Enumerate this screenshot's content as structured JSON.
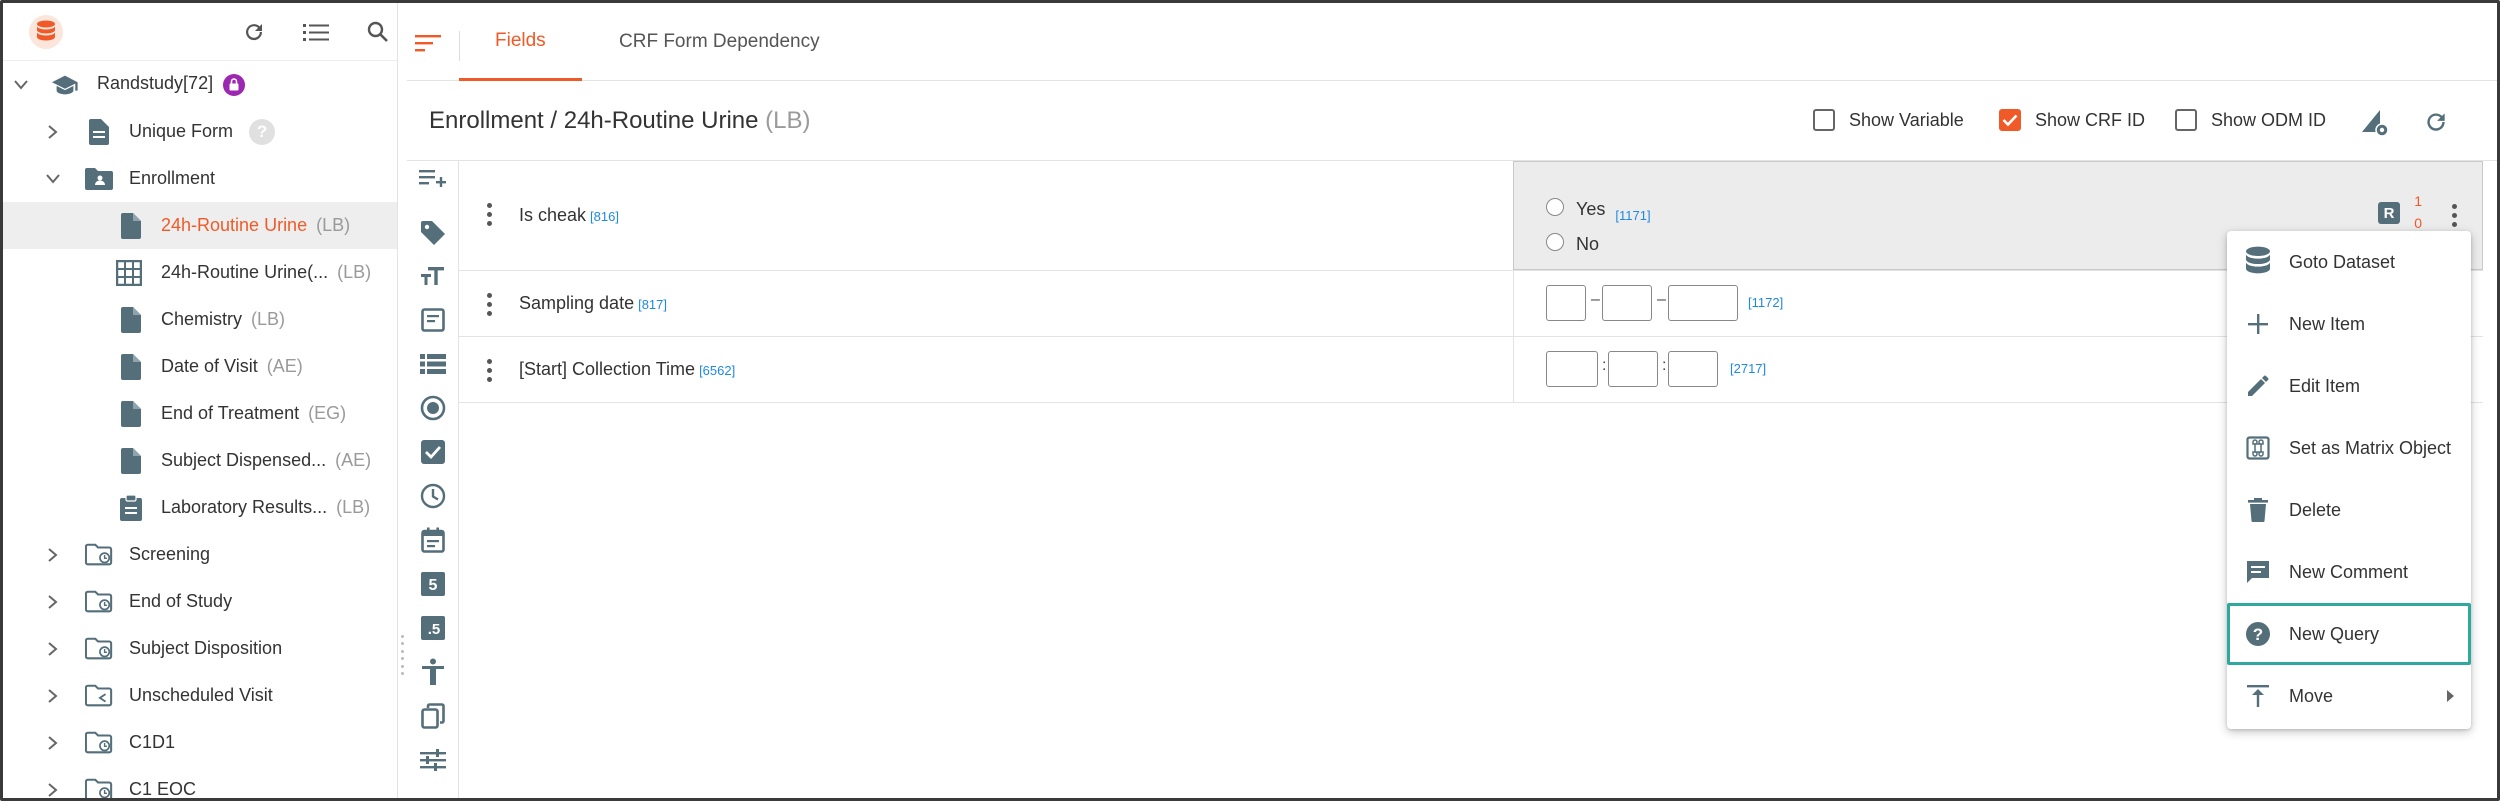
{
  "sidebar": {
    "study": {
      "label": "Randstudy[72]"
    },
    "items": [
      {
        "label": "Unique Form",
        "code": ""
      },
      {
        "label": "Enrollment",
        "code": ""
      },
      {
        "label": "24h-Routine Urine",
        "code": "(LB)"
      },
      {
        "label": "24h-Routine Urine(...",
        "code": "(LB)"
      },
      {
        "label": "Chemistry",
        "code": "(LB)"
      },
      {
        "label": "Date of Visit",
        "code": "(AE)"
      },
      {
        "label": "End of Treatment",
        "code": "(EG)"
      },
      {
        "label": "Subject Dispensed...",
        "code": "(AE)"
      },
      {
        "label": "Laboratory Results...",
        "code": "(LB)"
      },
      {
        "label": "Screening",
        "code": ""
      },
      {
        "label": "End of Study",
        "code": ""
      },
      {
        "label": "Subject Disposition",
        "code": ""
      },
      {
        "label": "Unscheduled Visit",
        "code": ""
      },
      {
        "label": "C1D1",
        "code": ""
      },
      {
        "label": "C1 EOC",
        "code": ""
      }
    ],
    "help_mark": "?"
  },
  "tabs": [
    {
      "label": "Fields"
    },
    {
      "label": "CRF Form Dependency"
    }
  ],
  "header": {
    "title": "Enrollment / 24h-Routine Urine",
    "code": "(LB)",
    "checkboxes": [
      {
        "label": "Show Variable",
        "checked": false
      },
      {
        "label": "Show CRF ID",
        "checked": true
      },
      {
        "label": "Show ODM ID",
        "checked": false
      }
    ]
  },
  "fields": [
    {
      "label": "Is cheak",
      "id": "[816]",
      "options": [
        {
          "label": "Yes"
        },
        {
          "label": "No"
        }
      ],
      "value_id": "[1171]",
      "badge": "R",
      "counts": [
        "1",
        "0"
      ]
    },
    {
      "label": "Sampling date",
      "id": "[817]",
      "value_id": "[1172]",
      "separator": "–"
    },
    {
      "label": "[Start] Collection Time",
      "id": "[6562]",
      "value_id": "[2717]",
      "separator": ":"
    }
  ],
  "context_menu": {
    "items": [
      {
        "label": "Goto Dataset",
        "icon": "database-icon"
      },
      {
        "label": "New Item",
        "icon": "plus-icon"
      },
      {
        "label": "Edit Item",
        "icon": "pencil-icon"
      },
      {
        "label": "Set as Matrix Object",
        "icon": "matrix-icon"
      },
      {
        "label": "Delete",
        "icon": "trash-icon"
      },
      {
        "label": "New Comment",
        "icon": "comment-icon"
      },
      {
        "label": "New Query",
        "icon": "help-circle-icon"
      },
      {
        "label": "Move",
        "icon": "move-top-icon"
      }
    ]
  },
  "colors": {
    "accent": "#f05a28",
    "highlight": "#2fa89e",
    "link": "#1e88e5",
    "badge": "#9c27b0"
  }
}
